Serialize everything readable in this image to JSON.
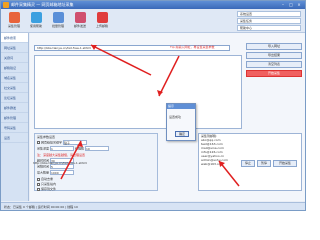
{
  "window": {
    "title": "邮件采集精灵 — 网页邮箱地址采集",
    "minimize_glyph": "–",
    "maximize_glyph": "□",
    "close_glyph": "×"
  },
  "toolbar": {
    "buttons": [
      {
        "label": "采集管理",
        "icon": "collect-icon",
        "color": "#e8643c"
      },
      {
        "label": "使用帮助",
        "icon": "help-icon",
        "color": "#3ca0e0"
      },
      {
        "label": "批量管理",
        "icon": "batch-icon",
        "color": "#5a8fd8"
      },
      {
        "label": "邮件发送",
        "icon": "mail-icon",
        "color": "#d0506e"
      },
      {
        "label": "上传邮箱",
        "icon": "upload-icon",
        "color": "#e03c3c"
      }
    ],
    "right_rows": [
      "系统设置",
      "采集任务",
      "帮助中心"
    ]
  },
  "sidebar": {
    "items": [
      "邮件搜索",
      "网址采集",
      "关键词",
      "邮箱验证",
      "域名采集",
      "社交采集",
      "论坛采集",
      "邮件群发",
      "邮件管理",
      "号码采集",
      "设置"
    ]
  },
  "main": {
    "url_value": "http://bbs.tianya.cn/list-free-1.shtml",
    "tip_text": "Tip:先输入网址，再设置采集参数",
    "right_buttons": [
      "导入网址",
      "导出结果",
      "清空列表",
      "开始采集"
    ],
    "settings": {
      "header": "采集参数设置",
      "keyword_label": "网页链接关键字",
      "keyword_value": "贴子",
      "depth_label": "采集深度",
      "depth_value": "1",
      "thread_label": "线程数",
      "thread_value": "10",
      "warning": "注：深度越大采集越慢，请合理设置",
      "timeout_label": "超时时间",
      "timeout_value": "30",
      "interval_label": "间隔时间",
      "interval_value": "5",
      "max_label": "最大数量",
      "max_value": "1000",
      "option1": "自动去重",
      "option2": "只采集站内",
      "option3": "保存到文件"
    },
    "list_items": [
      "采集到邮箱:",
      "abc@qq.com",
      "test@163.com",
      "mail@sina.com",
      "info@126.com",
      "user@yahoo.cn",
      "admin@sohu.com",
      "web@163.com"
    ],
    "bottom_url": "http://bbs.tianya.cn/list-free-1.shtml",
    "bottom_buttons": [
      "停止",
      "暂停",
      "开始采集"
    ]
  },
  "dialog": {
    "title": "提示",
    "message": "设置成功",
    "ok_label": "确定"
  },
  "status": {
    "text": "状态：已采集 0 个邮箱 | 运行时间 00:00:00 | 线程 10"
  }
}
